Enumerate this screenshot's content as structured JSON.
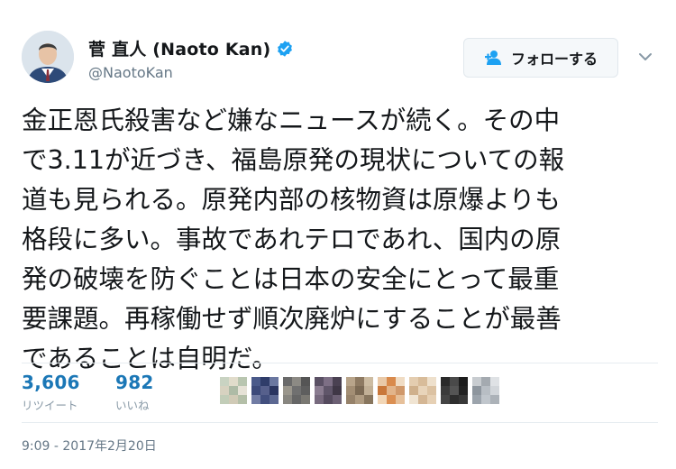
{
  "user": {
    "display_name": "菅 直人 (Naoto Kan)",
    "handle": "@NaotoKan"
  },
  "follow_button": {
    "label": "フォローする"
  },
  "tweet": {
    "lines": [
      "金正恩氏殺害など嫌なニュースが続く。その中",
      "で3.11が近づき、福島原発の現状についての報",
      "道も見られる。原発内部の核物資は原爆よりも",
      "格段に多い。事故であれテロであれ、国内の原",
      "発の破壊を防ぐことは日本の安全にとって最重",
      "要課題。再稼働せず順次廃炉にすることが最善",
      "であることは自明だ。"
    ]
  },
  "stats": {
    "retweets": {
      "count": "3,606",
      "label": "リツイート"
    },
    "likes": {
      "count": "982",
      "label": "いいね"
    }
  },
  "timestamp": "9:09 - 2017年2月20日",
  "colors": {
    "verified": "#1da1f2",
    "stat_count": "#1b77b6",
    "muted": "#657786"
  }
}
